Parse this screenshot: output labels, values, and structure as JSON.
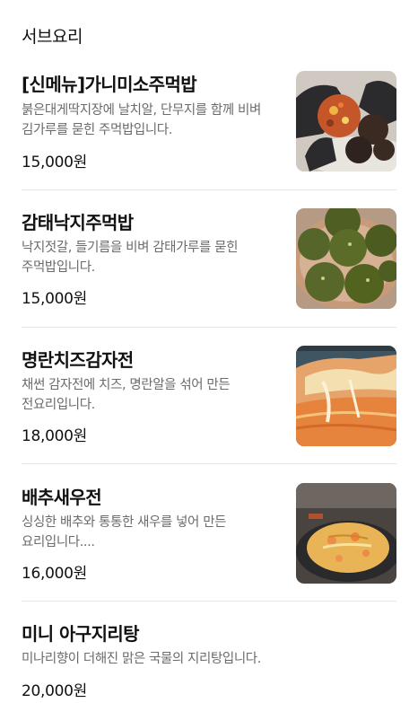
{
  "section": {
    "title": "서브요리"
  },
  "menu": [
    {
      "name": "[신메뉴]가니미소주먹밥",
      "description": "붉은대게딱지장에 날치알, 단무지를 함께 비벼 김가루를 묻힌 주먹밥입니다.",
      "price": "15,000원",
      "image_icon": "rice-ball-photo"
    },
    {
      "name": "감태낙지주먹밥",
      "description": "낙지젓갈, 들기름을 비벼 감태가루를 묻힌 주먹밥입니다.",
      "price": "15,000원",
      "image_icon": "seaweed-rice-ball-photo"
    },
    {
      "name": "명란치즈감자전",
      "description": "채썬 감자전에 치즈, 명란알을 섞어 만든 전요리입니다.",
      "price": "18,000원",
      "image_icon": "potato-pancake-photo"
    },
    {
      "name": "배추새우전",
      "description": "싱싱한 배추와 통통한 새우를 넣어 만든 요리입니다....",
      "price": "16,000원",
      "image_icon": "cabbage-shrimp-pancake-photo"
    },
    {
      "name": "미니 아구지리탕",
      "description": "미나리향이 더해진 맑은 국물의 지리탕입니다.",
      "price": "20,000원"
    }
  ]
}
